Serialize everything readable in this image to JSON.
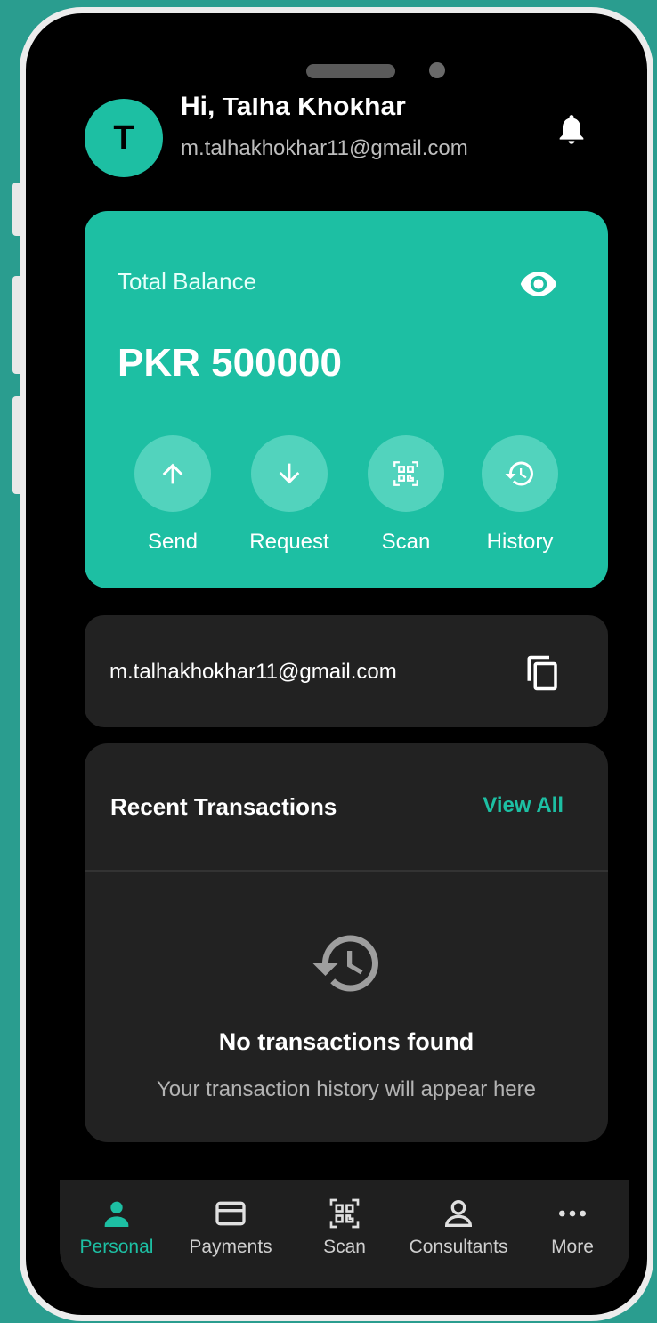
{
  "header": {
    "avatar_initial": "T",
    "greeting": "Hi, Talha Khokhar",
    "email": "m.talhakhokhar11@gmail.com",
    "icon": "bell-icon"
  },
  "balance_card": {
    "label": "Total Balance",
    "amount": "PKR 500000",
    "eye_icon": "eye-icon",
    "actions": [
      {
        "label": "Send",
        "icon": "arrow-up-icon"
      },
      {
        "label": "Request",
        "icon": "arrow-down-icon"
      },
      {
        "label": "Scan",
        "icon": "qr-scan-icon"
      },
      {
        "label": "History",
        "icon": "history-icon"
      }
    ]
  },
  "account_card": {
    "email": "m.talhakhokhar11@gmail.com",
    "icon": "copy-icon"
  },
  "transactions": {
    "title": "Recent Transactions",
    "view_all": "View All",
    "empty_title": "No transactions found",
    "empty_subtitle": "Your transaction history will appear here"
  },
  "bottom_nav": {
    "items": [
      {
        "label": "Personal",
        "icon": "person-icon",
        "active": true
      },
      {
        "label": "Payments",
        "icon": "card-icon",
        "active": false
      },
      {
        "label": "Scan",
        "icon": "qr-scan-icon",
        "active": false
      },
      {
        "label": "Consultants",
        "icon": "user-outline-icon",
        "active": false
      },
      {
        "label": "More",
        "icon": "more-dots-icon",
        "active": false
      }
    ]
  },
  "colors": {
    "accent": "#1dbfa3",
    "background": "#2a9d8f",
    "card": "#222222"
  }
}
